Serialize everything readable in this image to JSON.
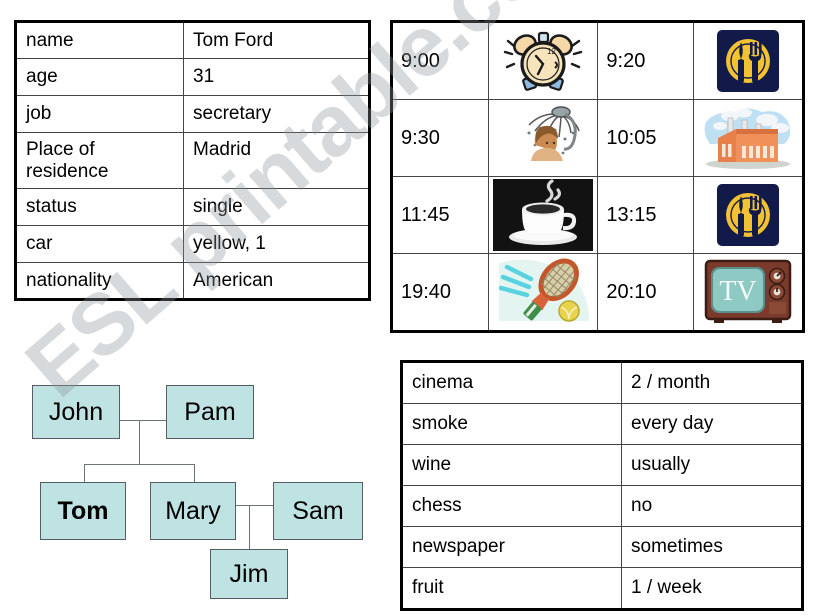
{
  "profile_table": {
    "rows": [
      {
        "key": "name",
        "value": "Tom Ford"
      },
      {
        "key": "age",
        "value": "31"
      },
      {
        "key": "job",
        "value": "secretary"
      },
      {
        "key": "Place of residence",
        "value": "Madrid"
      },
      {
        "key": "status",
        "value": "single"
      },
      {
        "key": "car",
        "value": "yellow, 1"
      },
      {
        "key": "nationality",
        "value": "American"
      }
    ]
  },
  "schedule_table": {
    "rows": [
      {
        "time_a": "9:00",
        "icon_a": "alarm-clock-icon",
        "time_b": "9:20",
        "icon_b": "cutlery-restaurant-icon"
      },
      {
        "time_a": "9:30",
        "icon_a": "shower-icon",
        "time_b": "10:05",
        "icon_b": "factory-icon"
      },
      {
        "time_a": "11:45",
        "icon_a": "coffee-cup-icon",
        "time_b": "13:15",
        "icon_b": "cutlery-restaurant-icon"
      },
      {
        "time_a": "19:40",
        "icon_a": "tennis-racket-icon",
        "time_b": "20:10",
        "icon_b": "television-icon"
      }
    ],
    "tv_label": "TV"
  },
  "habits_table": {
    "rows": [
      {
        "key": "cinema",
        "value": "2 / month"
      },
      {
        "key": "smoke",
        "value": "every day"
      },
      {
        "key": "wine",
        "value": "usually"
      },
      {
        "key": "chess",
        "value": "no"
      },
      {
        "key": "newspaper",
        "value": "sometimes"
      },
      {
        "key": "fruit",
        "value": "1 / week"
      }
    ]
  },
  "family_tree": {
    "nodes": [
      {
        "id": "john",
        "label": "John",
        "bold": false
      },
      {
        "id": "pam",
        "label": "Pam",
        "bold": false
      },
      {
        "id": "tom",
        "label": "Tom",
        "bold": true
      },
      {
        "id": "mary",
        "label": "Mary",
        "bold": false
      },
      {
        "id": "sam",
        "label": "Sam",
        "bold": false
      },
      {
        "id": "jim",
        "label": "Jim",
        "bold": false
      }
    ],
    "node_fill": "#bfe2e2",
    "node_border": "#555f63"
  },
  "watermark": {
    "text": "ESL printable.com"
  },
  "colors": {
    "table_border": "#000000",
    "cell_border": "#444444",
    "node_fill": "#bfe2e2",
    "restaurant_navy": "#121a4a",
    "restaurant_gold": "#f2c233",
    "factory_orange": "#e8804a",
    "factory_sky": "#bfe0f2",
    "tv_case": "#7a3a2c",
    "tv_screen": "#8fc9c4",
    "tennis_green": "#9fd64a",
    "coffee_bg": "#1a1a1a"
  }
}
